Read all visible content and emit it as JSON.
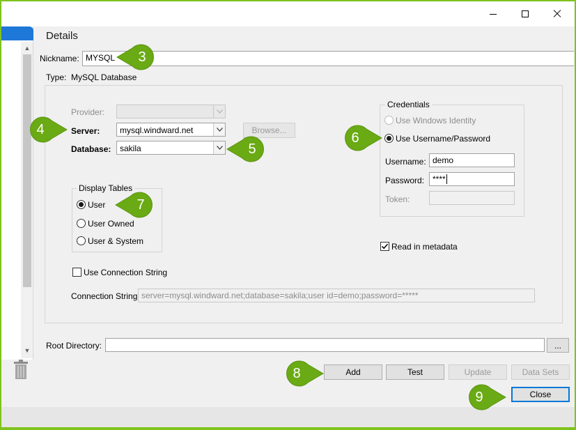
{
  "details": {
    "heading": "Details",
    "nickname_label": "Nickname:",
    "nickname_value": "MYSQL",
    "type_label": "Type:",
    "type_value": "MySQL Database"
  },
  "connection": {
    "provider_label": "Provider:",
    "provider_value": "",
    "server_label": "Server:",
    "server_value": "mysql.windward.net",
    "browse_label": "Browse...",
    "database_label": "Database:",
    "database_value": "sakila"
  },
  "display_tables": {
    "title": "Display Tables",
    "options": [
      "User",
      "User Owned",
      "User & System"
    ],
    "selected": "User"
  },
  "credentials": {
    "title": "Credentials",
    "windows_identity_label": "Use Windows Identity",
    "username_password_label": "Use Username/Password",
    "username_label": "Username:",
    "username_value": "demo",
    "password_label": "Password:",
    "password_value": "****",
    "token_label": "Token:",
    "token_value": ""
  },
  "read_metadata_label": "Read in metadata",
  "read_metadata_checked": true,
  "use_connection_string_label": "Use Connection String",
  "use_connection_string_checked": false,
  "connection_string_label": "Connection String:",
  "connection_string_value": "server=mysql.windward.net;database=sakila;user id=demo;password=*****",
  "root_directory_label": "Root Directory:",
  "root_directory_value": "",
  "root_browse_label": "...",
  "buttons": {
    "add": "Add",
    "test": "Test",
    "update": "Update",
    "data_sets": "Data Sets",
    "close": "Close"
  },
  "callouts": [
    "3",
    "4",
    "5",
    "6",
    "7",
    "8",
    "9"
  ],
  "colors": {
    "accent_green": "#7fc31c",
    "callout_green": "#6aaa14",
    "focus_blue": "#0078d7",
    "tab_blue": "#1e78d7"
  }
}
